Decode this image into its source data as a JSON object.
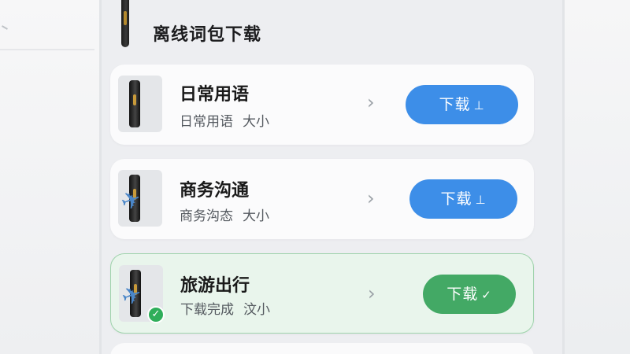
{
  "page": {
    "title": "离线词包下载"
  },
  "packs": [
    {
      "title": "日常用语",
      "subtitle": "日常用语",
      "size_label": "大小",
      "button_label": "下载",
      "button_icon": "⊥",
      "status": "not-downloaded"
    },
    {
      "title": "商务沟通",
      "subtitle": "商务沟态",
      "size_label": "大小",
      "button_label": "下载",
      "button_icon": "⊥",
      "status": "not-downloaded"
    },
    {
      "title": "旅游出行",
      "subtitle": "下载完成",
      "size_label": "汶小",
      "button_label": "下载",
      "button_icon": "✓",
      "status": "downloaded"
    }
  ],
  "colors": {
    "download_blue": "#3d8ee8",
    "done_green": "#43a965",
    "done_card_bg": "#e9f5ec"
  },
  "icons": {
    "chevron": "›",
    "check": "✓",
    "plane": "✈"
  }
}
